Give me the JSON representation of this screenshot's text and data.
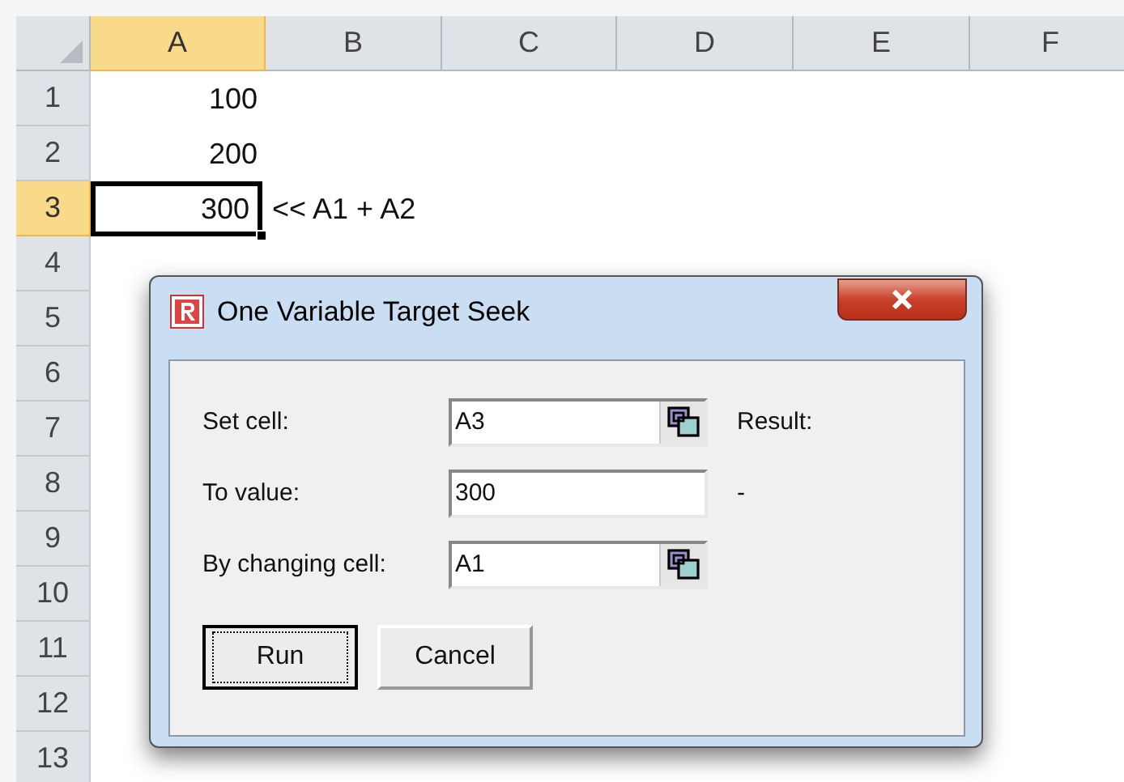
{
  "sheet": {
    "columns": [
      {
        "label": "A",
        "selected": true
      },
      {
        "label": "B",
        "selected": false
      },
      {
        "label": "C",
        "selected": false
      },
      {
        "label": "D",
        "selected": false
      },
      {
        "label": "E",
        "selected": false
      },
      {
        "label": "F",
        "selected": false
      }
    ],
    "rows": [
      {
        "label": "1",
        "selected": false,
        "cells": [
          {
            "value": "100",
            "kind": "number",
            "active": false
          }
        ]
      },
      {
        "label": "2",
        "selected": false,
        "cells": [
          {
            "value": "200",
            "kind": "number",
            "active": false
          }
        ]
      },
      {
        "label": "3",
        "selected": true,
        "cells": [
          {
            "value": "300",
            "kind": "number",
            "active": true
          },
          {
            "value": "<< A1 + A2",
            "kind": "text",
            "active": false
          }
        ]
      },
      {
        "label": "4",
        "selected": false,
        "cells": []
      },
      {
        "label": "5",
        "selected": false,
        "cells": []
      },
      {
        "label": "6",
        "selected": false,
        "cells": []
      },
      {
        "label": "7",
        "selected": false,
        "cells": []
      },
      {
        "label": "8",
        "selected": false,
        "cells": []
      },
      {
        "label": "9",
        "selected": false,
        "cells": []
      },
      {
        "label": "10",
        "selected": false,
        "cells": []
      },
      {
        "label": "11",
        "selected": false,
        "cells": []
      },
      {
        "label": "12",
        "selected": false,
        "cells": []
      },
      {
        "label": "13",
        "selected": false,
        "cells": []
      }
    ]
  },
  "dialog": {
    "title": "One Variable Target Seek",
    "fields": [
      {
        "label": "Set cell:",
        "value": "A3",
        "kind": "reference",
        "note": "Result:"
      },
      {
        "label": "To value:",
        "value": "300",
        "kind": "plain",
        "note": "-"
      },
      {
        "label": "By changing cell:",
        "value": "A1",
        "kind": "reference"
      }
    ],
    "buttons": [
      {
        "label": "Run",
        "default": true
      },
      {
        "label": "Cancel",
        "default": false
      }
    ]
  }
}
